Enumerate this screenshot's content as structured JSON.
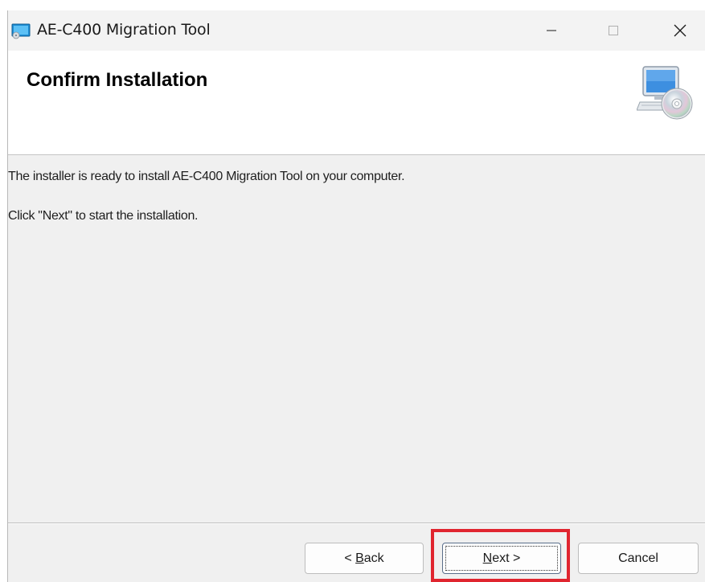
{
  "window": {
    "title": "AE-C400 Migration Tool",
    "controls": {
      "minimize": "—",
      "maximize": "☐",
      "close": "✕"
    }
  },
  "banner": {
    "heading": "Confirm Installation",
    "icon": "computer-cd-icon"
  },
  "content": {
    "line1": "The installer is ready to install AE-C400 Migration Tool on your computer.",
    "line2": "Click \"Next\" to start the installation."
  },
  "buttons": {
    "back": {
      "prefix": "< ",
      "accel": "B",
      "rest": "ack"
    },
    "next": {
      "accel": "N",
      "rest": "ext",
      "suffix": " >"
    },
    "cancel": "Cancel"
  },
  "colors": {
    "highlight": "#e0252f",
    "window_bg": "#f0f0f0"
  }
}
